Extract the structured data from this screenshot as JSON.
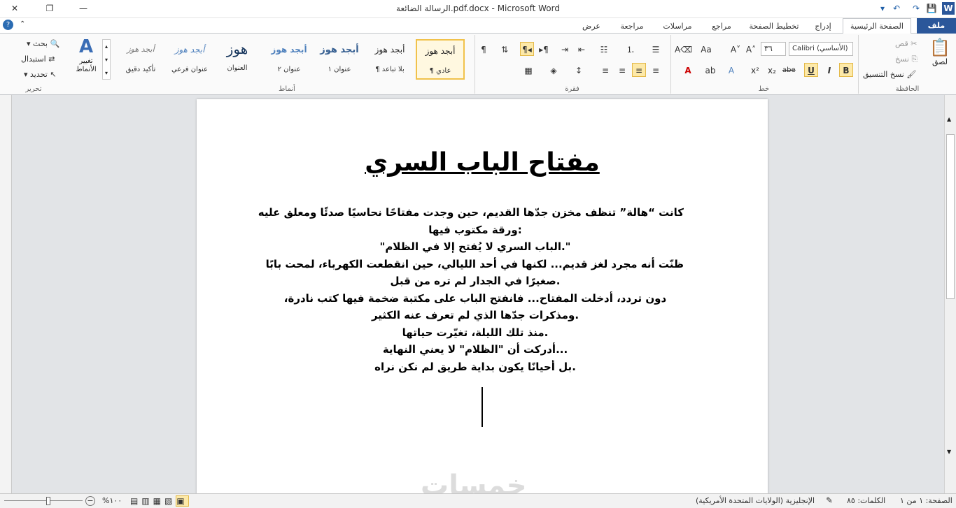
{
  "window": {
    "title": "الرسالة الضائعة.pdf.docx  -  Microsoft Word",
    "minimize": "—",
    "restore": "❐",
    "close": "✕"
  },
  "qat": {
    "word_logo": "W",
    "save": "💾",
    "undo": "↶",
    "redo": "↷",
    "customize": "▾"
  },
  "tabs": [
    "ملف",
    "الصفحة الرئيسية",
    "إدراج",
    "تخطيط الصفحة",
    "مراجع",
    "مراسلات",
    "مراجعة",
    "عرض"
  ],
  "clipboard": {
    "label": "الحافظة",
    "paste": "لصق",
    "cut": "قص",
    "copy": "نسخ",
    "format_painter": "نسخ التنسيق"
  },
  "font": {
    "label": "خط",
    "name": "Calibri (الأساسي)",
    "size": "٣٦",
    "bold": "B",
    "italic": "I",
    "underline": "U",
    "strike": "abe",
    "subscript": "x₂",
    "superscript": "x²"
  },
  "paragraph": {
    "label": "فقرة"
  },
  "styles": {
    "label": "أنماط",
    "items": [
      {
        "sample": "أبجد هوز",
        "name": "¶ عادي"
      },
      {
        "sample": "أبجد هوز",
        "name": "¶ بلا تباعد"
      },
      {
        "sample": "أبجد هوز",
        "name": "عنوان ١"
      },
      {
        "sample": "أبجد هوز",
        "name": "عنوان ٢"
      },
      {
        "sample": "هوز",
        "name": "العنوان"
      },
      {
        "sample": "أبجد هوز",
        "name": "عنوان فرعي"
      },
      {
        "sample": "أبجد هوز",
        "name": "تأكيد دقيق"
      }
    ],
    "change_styles": "تغيير الأنماط"
  },
  "editing": {
    "label": "تحرير",
    "find": "بحث",
    "replace": "استبدال",
    "select": "تحديد"
  },
  "document": {
    "title": "مفتاح الباب السري",
    "lines": [
      "كانت “هالة” تنظف مخزن جدّها القديم، حين وجدت مفتاحًا نحاسيًا صدئًا ومعلق عليه",
      ":ورقة مكتوب فيها",
      "\".الباب السري لا يُفتح إلا في الظلام\"",
      "ظنّت أنه مجرد لغز قديم... لكنها في أحد الليالي، حين انقطعت الكهرباء، لمحت بابًا",
      ".صغيرًا في الجدار لم تره من قبل",
      "دون تردد، أدخلت المفتاح... فانفتح الباب على مكتبة ضخمة فيها كتب نادرة،",
      ".ومذكرات جدّها الذي لم تعرف عنه الكثير",
      ".منذ تلك الليلة، تغيّرت حياتها",
      "...أدركت أن \"الظلام\" لا يعني النهاية",
      ".بل أحيانًا يكون بداية طريق لم نكن نراه"
    ],
    "watermark": "خمسات"
  },
  "status": {
    "page": "الصفحة: ١ من ١",
    "words": "الكلمات: ٨٥",
    "language": "الإنجليزية (الولايات المتحدة الأمريكية)",
    "zoom": "١٠٠%"
  }
}
